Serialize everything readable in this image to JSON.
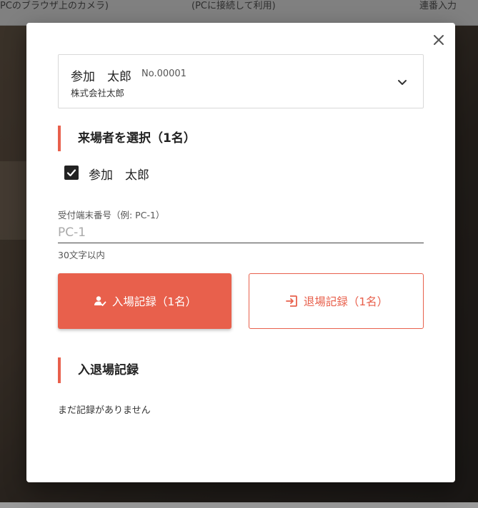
{
  "background": {
    "tabs": [
      {
        "label": "PCのブラウザ上のカメラ)"
      },
      {
        "label": "(PCに接続して利用)"
      },
      {
        "label": "連番入力"
      }
    ]
  },
  "modal": {
    "close_icon": "close-icon",
    "attendee": {
      "name": "参加　太郎",
      "number": "No.00001",
      "company": "株式会社太郎",
      "dropdown_icon": "chevron-down-icon"
    },
    "select_section": {
      "title": "来場者を選択（1名）",
      "attendees": [
        {
          "name": "参加　太郎",
          "checked": true
        }
      ]
    },
    "terminal_field": {
      "label": "受付端末番号（例: PC-1）",
      "placeholder": "PC-1",
      "value": "",
      "help": "30文字以内"
    },
    "buttons": {
      "entry": {
        "label": "入場記録（1名）",
        "icon": "person-check-icon"
      },
      "exit": {
        "label": "退場記録（1名）",
        "icon": "exit-icon"
      }
    },
    "records_section": {
      "title": "入退場記録",
      "empty_message": "まだ記録がありません"
    },
    "colors": {
      "accent": "#e8604c",
      "text": "#222222"
    }
  }
}
